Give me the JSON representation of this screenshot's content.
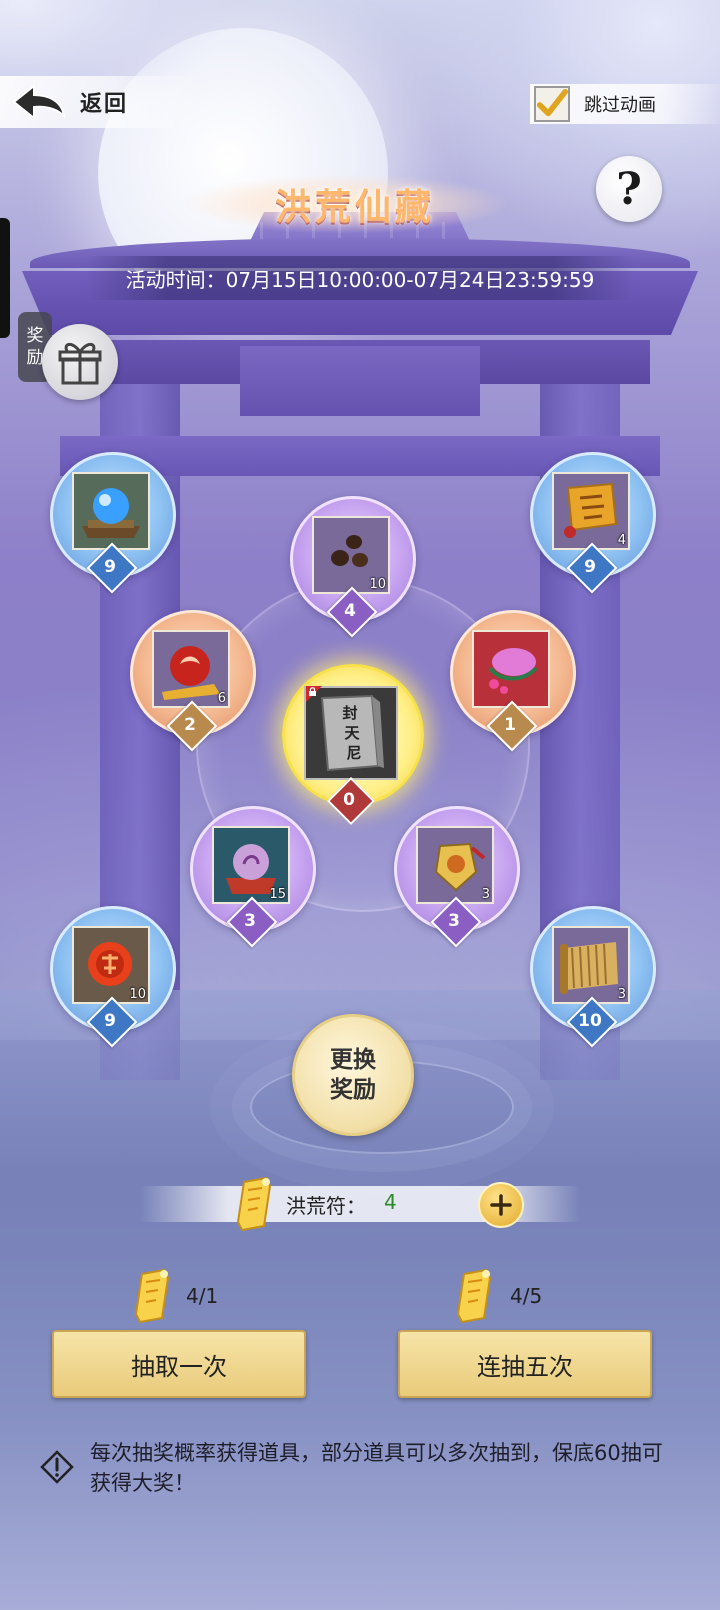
{
  "header": {
    "back_label": "返回",
    "skip_label": "跳过动画",
    "skip_checked": true,
    "help_label": "?"
  },
  "event": {
    "title": "洪荒仙藏",
    "time": "活动时间：07月15日10:00:00-07月24日23:59:59"
  },
  "side": {
    "reward_tag_1": "奖",
    "reward_tag_2": "励"
  },
  "items": [
    {
      "id": "top-left",
      "tier": "blue",
      "quantity": "",
      "count": "9",
      "icon": "crystal-orb-icon"
    },
    {
      "id": "top-center",
      "tier": "purple",
      "quantity": "10",
      "count": "4",
      "icon": "seeds-icon"
    },
    {
      "id": "top-right",
      "tier": "blue",
      "quantity": "4",
      "count": "9",
      "icon": "scroll-token-icon"
    },
    {
      "id": "mid-left",
      "tier": "orange",
      "quantity": "6",
      "count": "2",
      "icon": "fire-orb-icon"
    },
    {
      "id": "mid-right",
      "tier": "orange",
      "quantity": "",
      "count": "1",
      "icon": "flower-crown-icon"
    },
    {
      "id": "low-left",
      "tier": "purple",
      "quantity": "15",
      "count": "3",
      "icon": "spirit-orb-icon"
    },
    {
      "id": "low-right",
      "tier": "purple",
      "quantity": "3",
      "count": "3",
      "icon": "amulet-icon"
    },
    {
      "id": "bottom-left",
      "tier": "blue",
      "quantity": "10",
      "count": "9",
      "icon": "fire-seal-icon"
    },
    {
      "id": "bottom-right",
      "tier": "blue",
      "quantity": "3",
      "count": "10",
      "icon": "bamboo-scroll-icon"
    }
  ],
  "grand_prize": {
    "label_text": "封天尼",
    "count": "0",
    "icon": "sealed-book-icon"
  },
  "change_button": {
    "line1": "更换",
    "line2": "奖励"
  },
  "currency": {
    "label": "洪荒符：",
    "value": "4"
  },
  "draw_single": {
    "cost": "4/1",
    "label": "抽取一次"
  },
  "draw_five": {
    "cost": "4/5",
    "label": "连抽五次"
  },
  "notice": "每次抽奖概率获得道具，部分道具可以多次抽到，保底60抽可获得大奖！"
}
